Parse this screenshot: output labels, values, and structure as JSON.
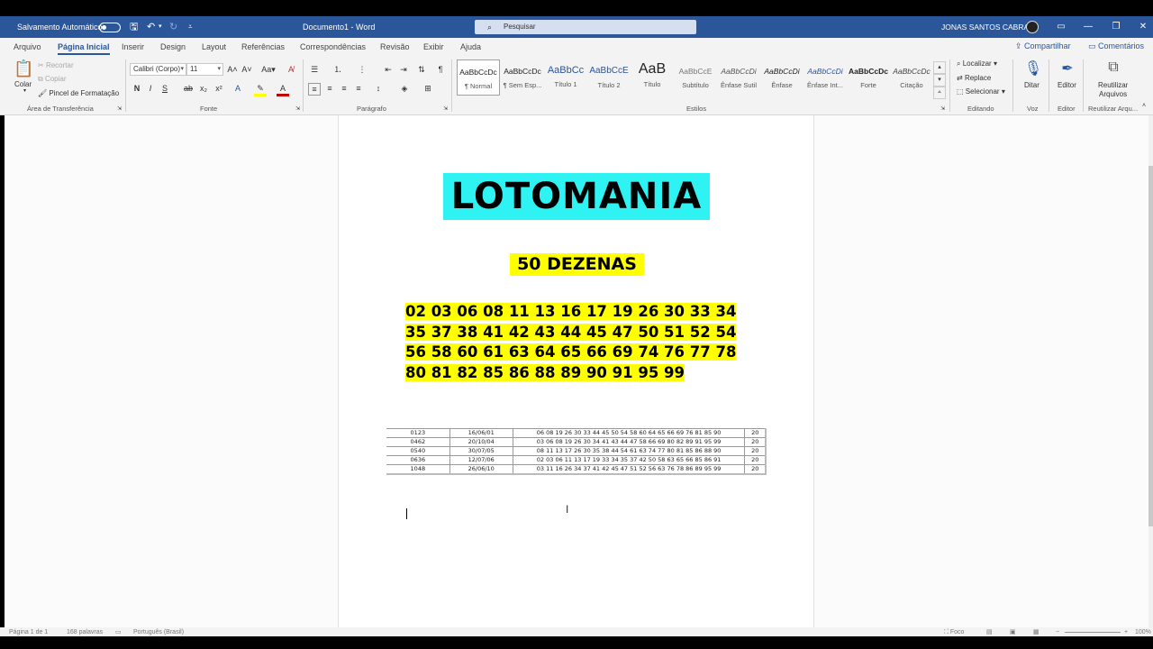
{
  "titlebar": {
    "autosave_label": "Salvamento Automático",
    "document_title": "Documento1 - Word",
    "search_placeholder": "Pesquisar",
    "user_name": "JONAS SANTOS CABRAL"
  },
  "tabs": [
    "Arquivo",
    "Página Inicial",
    "Inserir",
    "Design",
    "Layout",
    "Referências",
    "Correspondências",
    "Revisão",
    "Exibir",
    "Ajuda"
  ],
  "tabs_right": {
    "share": "Compartilhar",
    "comments": "Comentários"
  },
  "ribbon": {
    "clipboard": {
      "paste": "Colar",
      "cut": "Recortar",
      "copy": "Copiar",
      "format_painter": "Pincel de Formatação",
      "label": "Área de Transferência"
    },
    "font": {
      "family": "Calibri (Corpo)",
      "size": "11",
      "label": "Fonte"
    },
    "paragraph": {
      "label": "Parágrafo"
    },
    "styles": {
      "label": "Estilos",
      "items": [
        {
          "preview": "AaBbCcDc",
          "name": "¶ Normal"
        },
        {
          "preview": "AaBbCcDc",
          "name": "¶ Sem Esp..."
        },
        {
          "preview": "AaBbCc",
          "name": "Título 1"
        },
        {
          "preview": "AaBbCcE",
          "name": "Título 2"
        },
        {
          "preview": "AaB",
          "name": "Título"
        },
        {
          "preview": "AaBbCcE",
          "name": "Subtítulo"
        },
        {
          "preview": "AaBbCcDi",
          "name": "Ênfase Sutil"
        },
        {
          "preview": "AaBbCcDi",
          "name": "Ênfase"
        },
        {
          "preview": "AaBbCcDi",
          "name": "Ênfase Int..."
        },
        {
          "preview": "AaBbCcDc",
          "name": "Forte"
        },
        {
          "preview": "AaBbCcDc",
          "name": "Citação"
        }
      ]
    },
    "editing": {
      "find": "Localizar",
      "replace": "Replace",
      "select": "Selecionar",
      "label": "Editando"
    },
    "voice": {
      "dictate": "Ditar",
      "label": "Voz"
    },
    "editor": {
      "editor": "Editor",
      "label": "Editor"
    },
    "reuse": {
      "line1": "Reutilizar",
      "line2": "Arquivos",
      "label": "Reutilizar Arqu..."
    }
  },
  "document": {
    "title": "LOTOMANIA",
    "subtitle": "50 DEZENAS",
    "number_lines": [
      "02 03 06 08 11 13 16 17 19 26 30 33 34",
      "35 37 38 41 42 43 44 45 47 50 51 52 54",
      "56 58 60 61 63 64 65 66 69 74 76 77 78",
      "80 81 82 85 86 88 89 90 91 95 99"
    ],
    "table": [
      {
        "id": "0123",
        "date": "16/06/01",
        "numbers": "06 08 19 26 30 33 44 45 50 54 58 60 64 65 66 69 76 81 85 90",
        "hits": "20"
      },
      {
        "id": "0462",
        "date": "20/10/04",
        "numbers": "03 06 08 19 26 30 34 41 43 44 47 58 66 69 80 82 89 91 95 99",
        "hits": "20"
      },
      {
        "id": "0540",
        "date": "30/07/05",
        "numbers": "08 11 13 17 26 30 35 38 44 54 61 63 74 77 80 81 85 86 88 90",
        "hits": "20"
      },
      {
        "id": "0636",
        "date": "12/07/06",
        "numbers": "02 03 06 11 13 17 19 33 34 35 37 42 50 58 63 65 66 85 86 91",
        "hits": "20"
      },
      {
        "id": "1048",
        "date": "26/06/10",
        "numbers": "03 11 16 26 34 37 41 42 45 47 51 52 56 63 76 78 86 89 95 99",
        "hits": "20"
      }
    ]
  },
  "statusbar": {
    "page": "Página 1 de 1",
    "words": "168 palavras",
    "language": "Português (Brasil)",
    "focus": "Foco",
    "zoom": "100%"
  },
  "colors": {
    "word_blue": "#2b579a",
    "title_highlight": "#2ff2f2",
    "yellow_highlight": "#ffff00"
  }
}
